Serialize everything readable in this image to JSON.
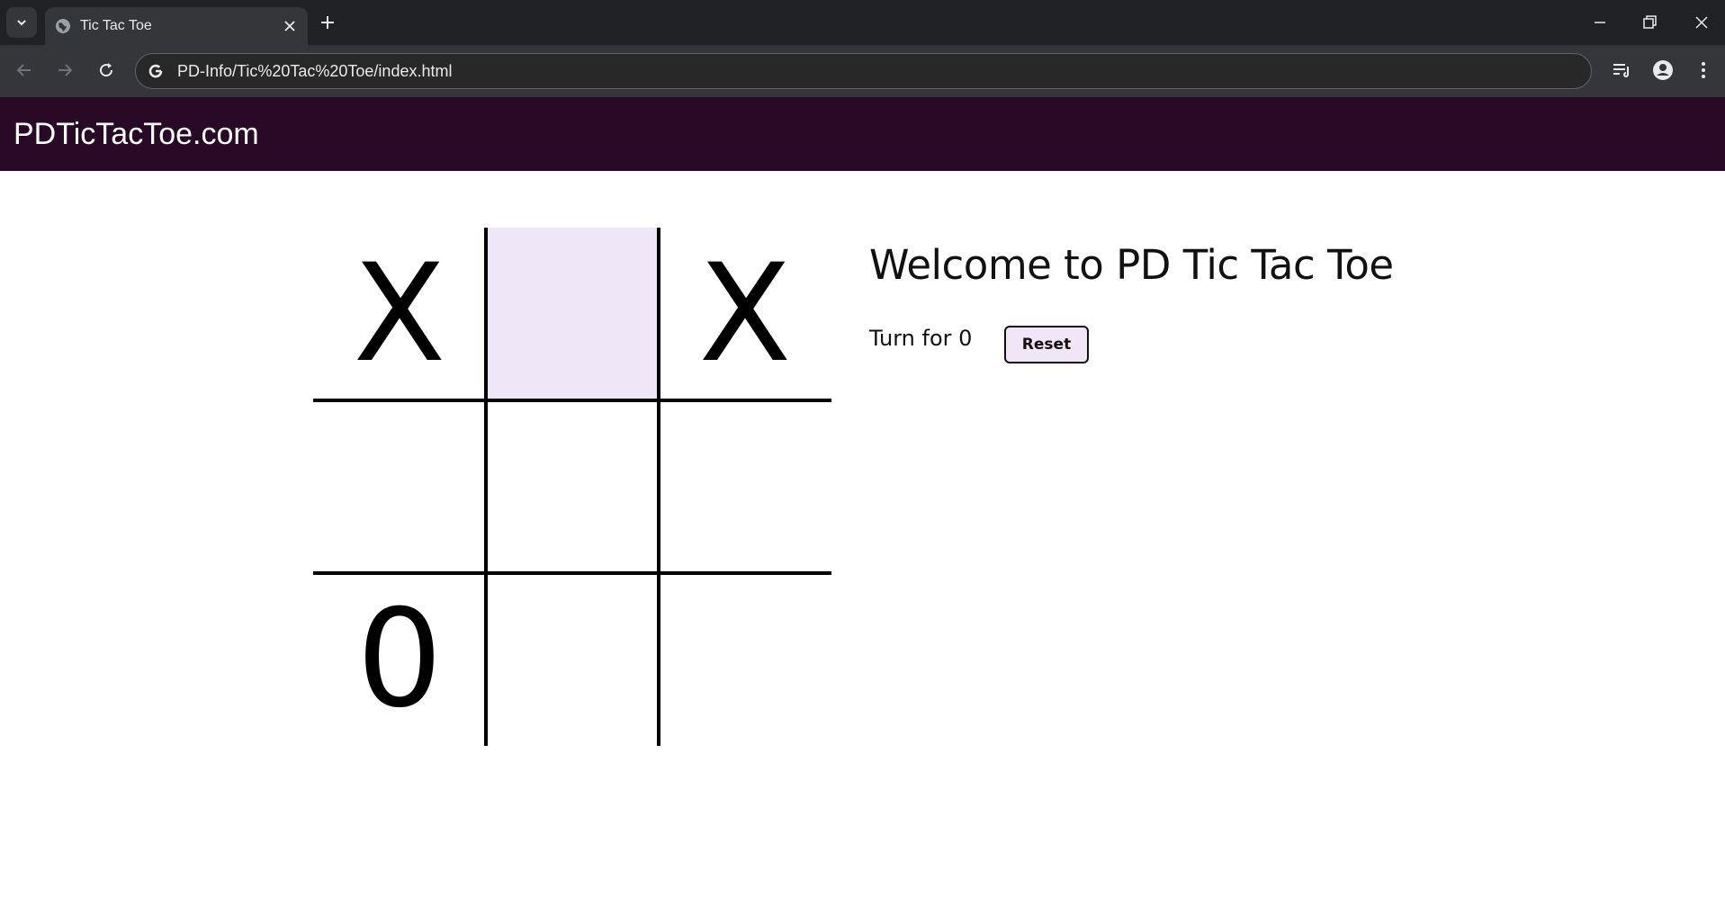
{
  "browser": {
    "tab_title": "Tic Tac Toe",
    "url": "PD-Info/Tic%20Tac%20Toe/index.html"
  },
  "site": {
    "title": "PDTicTacToe.com"
  },
  "game": {
    "heading": "Welcome to PD Tic Tac Toe",
    "turn_text": "Turn for 0",
    "reset_label": "Reset",
    "board": [
      [
        "X",
        "",
        "X"
      ],
      [
        "",
        "",
        ""
      ],
      [
        "0",
        "",
        ""
      ]
    ],
    "highlighted_cell": [
      0,
      1
    ]
  },
  "colors": {
    "header_bg": "#290a26",
    "highlight_cell": "#efe6f7",
    "reset_button_bg": "#f1e6f7"
  }
}
